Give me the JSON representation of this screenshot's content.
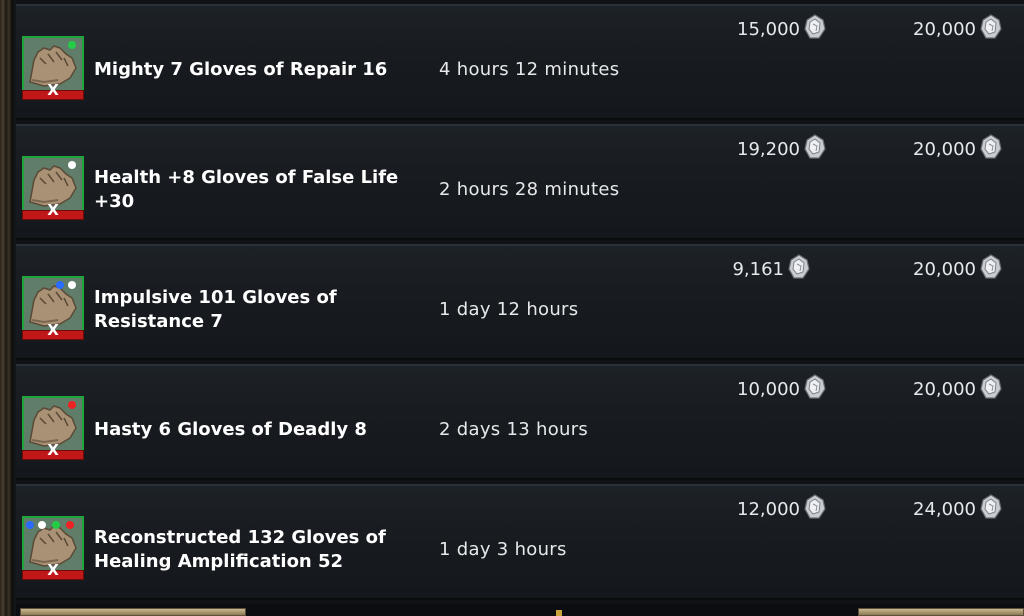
{
  "listings": [
    {
      "name": "Mighty 7 Gloves of Repair 16",
      "time_left": "4 hours 12 minutes",
      "bid": "15,000",
      "buyout": "20,000",
      "remove_label": "X",
      "gem_dots": [
        "#22cc44"
      ]
    },
    {
      "name": "Health +8 Gloves of False Life +30",
      "time_left": "2 hours 28 minutes",
      "bid": "19,200",
      "buyout": "20,000",
      "remove_label": "X",
      "gem_dots": [
        "#ffffff"
      ]
    },
    {
      "name": "Impulsive 101 Gloves of Resistance 7",
      "time_left": "1 day 12 hours",
      "bid": "9,161",
      "buyout": "20,000",
      "remove_label": "X",
      "gem_dots": [
        "#2a6cff",
        "#ffffff"
      ]
    },
    {
      "name": "Hasty 6 Gloves of Deadly 8",
      "time_left": "2 days 13 hours",
      "bid": "10,000",
      "buyout": "20,000",
      "remove_label": "X",
      "gem_dots": [
        "#ee2222"
      ]
    },
    {
      "name": "Reconstructed 132 Gloves of Healing Amplification 52",
      "time_left": "1 day 3 hours",
      "bid": "12,000",
      "buyout": "24,000",
      "remove_label": "X",
      "gem_dots": [
        "#2a6cff",
        "#ffffff",
        "#22cc44",
        "#ee2222"
      ]
    }
  ],
  "currency_icon": "platinum-coin-icon",
  "item_icon": "gloves-icon",
  "colors": {
    "row_bg": "#181c21",
    "icon_border": "#1fa63a",
    "remove_bar": "#c01818",
    "text": "#e6e8ea"
  }
}
